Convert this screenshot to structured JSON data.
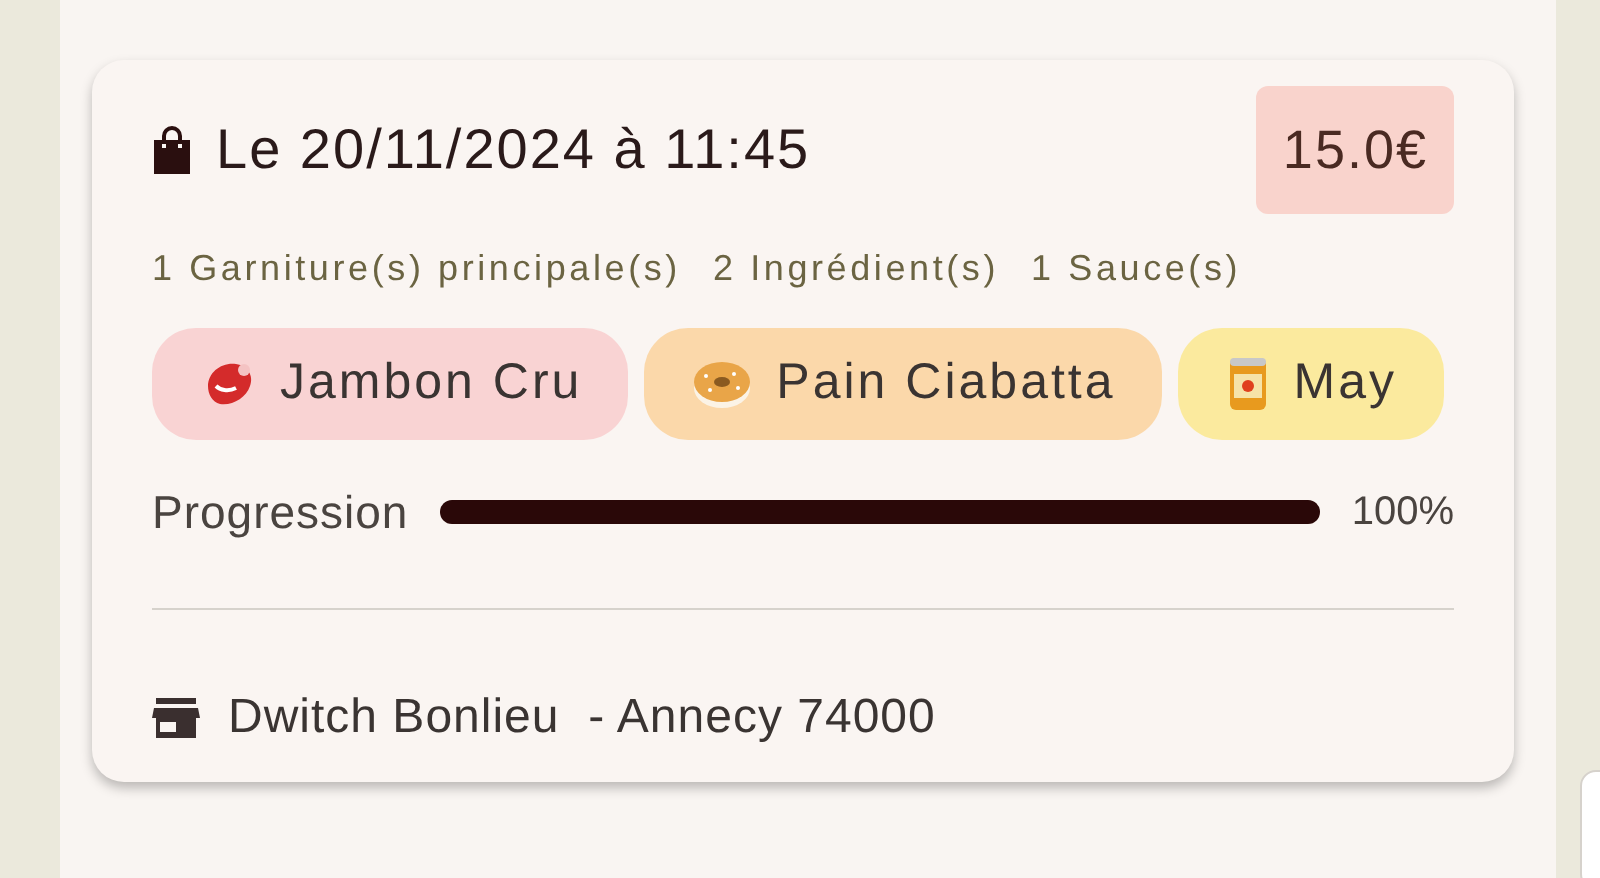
{
  "order": {
    "title": "Le 20/11/2024 à 11:45",
    "price": "15.0€",
    "counts": [
      "1 Garniture(s) principale(s)",
      "2 Ingrédient(s)",
      "1 Sauce(s)"
    ],
    "ingredients": [
      {
        "kind": "meat",
        "label": "Jambon Cru",
        "color": "#f9d3d3"
      },
      {
        "kind": "bread",
        "label": "Pain Ciabatta",
        "color": "#fbd8aa"
      },
      {
        "kind": "sauce",
        "label": "May",
        "color": "#fbea9e"
      }
    ],
    "progress": {
      "label": "Progression",
      "level": 1,
      "reading": "100%"
    },
    "store": "Dwitch Bonlieu  - Annecy 74000"
  }
}
